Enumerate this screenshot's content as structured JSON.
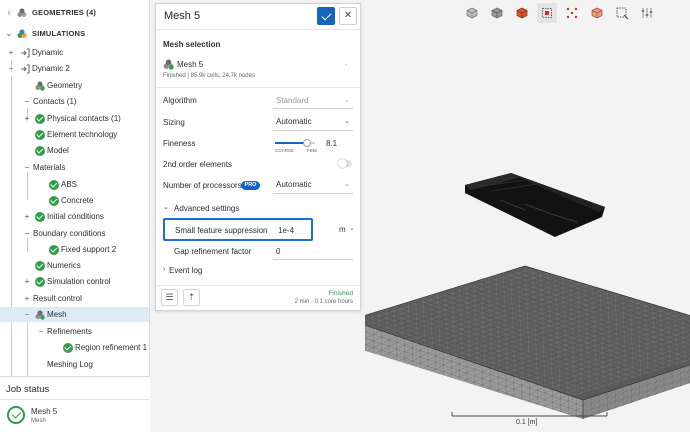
{
  "tree": {
    "items": [
      {
        "label": "GEOMETRIES (4)",
        "bold": true
      },
      {
        "label": "SIMULATIONS",
        "bold": true
      },
      {
        "label": "Dynamic"
      },
      {
        "label": "Dynamic 2"
      },
      {
        "label": "Geometry"
      },
      {
        "label": "Contacts (1)"
      },
      {
        "label": "Physical contacts (1)"
      },
      {
        "label": "Element technology"
      },
      {
        "label": "Model"
      },
      {
        "label": "Materials"
      },
      {
        "label": "ABS"
      },
      {
        "label": "Concrete"
      },
      {
        "label": "Initial conditions"
      },
      {
        "label": "Boundary conditions"
      },
      {
        "label": "Fixed support 2"
      },
      {
        "label": "Numerics"
      },
      {
        "label": "Simulation control"
      },
      {
        "label": "Result control"
      },
      {
        "label": "Mesh"
      },
      {
        "label": "Refinements"
      },
      {
        "label": "Region refinement 1"
      },
      {
        "label": "Meshing Log"
      }
    ]
  },
  "job_status": {
    "title": "Job status",
    "job_name": "Mesh 5",
    "job_type": "Mesh"
  },
  "dialog": {
    "title": "Mesh 5",
    "close_glyph": "✕",
    "mesh_selection_heading": "Mesh selection",
    "mesh_name": "Mesh 5",
    "mesh_info": "Finished | 85.9k cells, 24.7k nodes",
    "algorithm_label": "Algorithm",
    "algorithm_value": "Standard",
    "sizing_label": "Sizing",
    "sizing_value": "Automatic",
    "fineness_label": "Fineness",
    "fineness_value": "8.1",
    "fineness_fraction": 0.81,
    "coarse_label": "COARSE",
    "fine_label": "FINE",
    "second_order_label": "2nd order elements",
    "processors_label": "Number of processors",
    "pro_badge": "PRO",
    "processors_value": "Automatic",
    "advanced_heading": "Advanced settings",
    "small_feature_label": "Small feature suppression",
    "small_feature_value": "1e-4",
    "small_feature_unit": "m",
    "gap_label": "Gap refinement factor",
    "gap_value": "0",
    "event_log_label": "Event log",
    "status_text": "Finished",
    "duration_text": "2 min · 0.1 core hours"
  },
  "viewport": {
    "scale_label": "0.1 [m]",
    "toolbar_icons": [
      "view-iso-icon",
      "view-iso2-icon",
      "view-top-icon",
      "view-front-icon",
      "view-points-icon",
      "view-cube-icon",
      "box-select-icon",
      "settings-icon"
    ]
  },
  "colors": {
    "accent": "#1565c0",
    "success": "#2e9e4a",
    "selection": "#dcebf5",
    "mesh_face": "#5a5a5a"
  }
}
